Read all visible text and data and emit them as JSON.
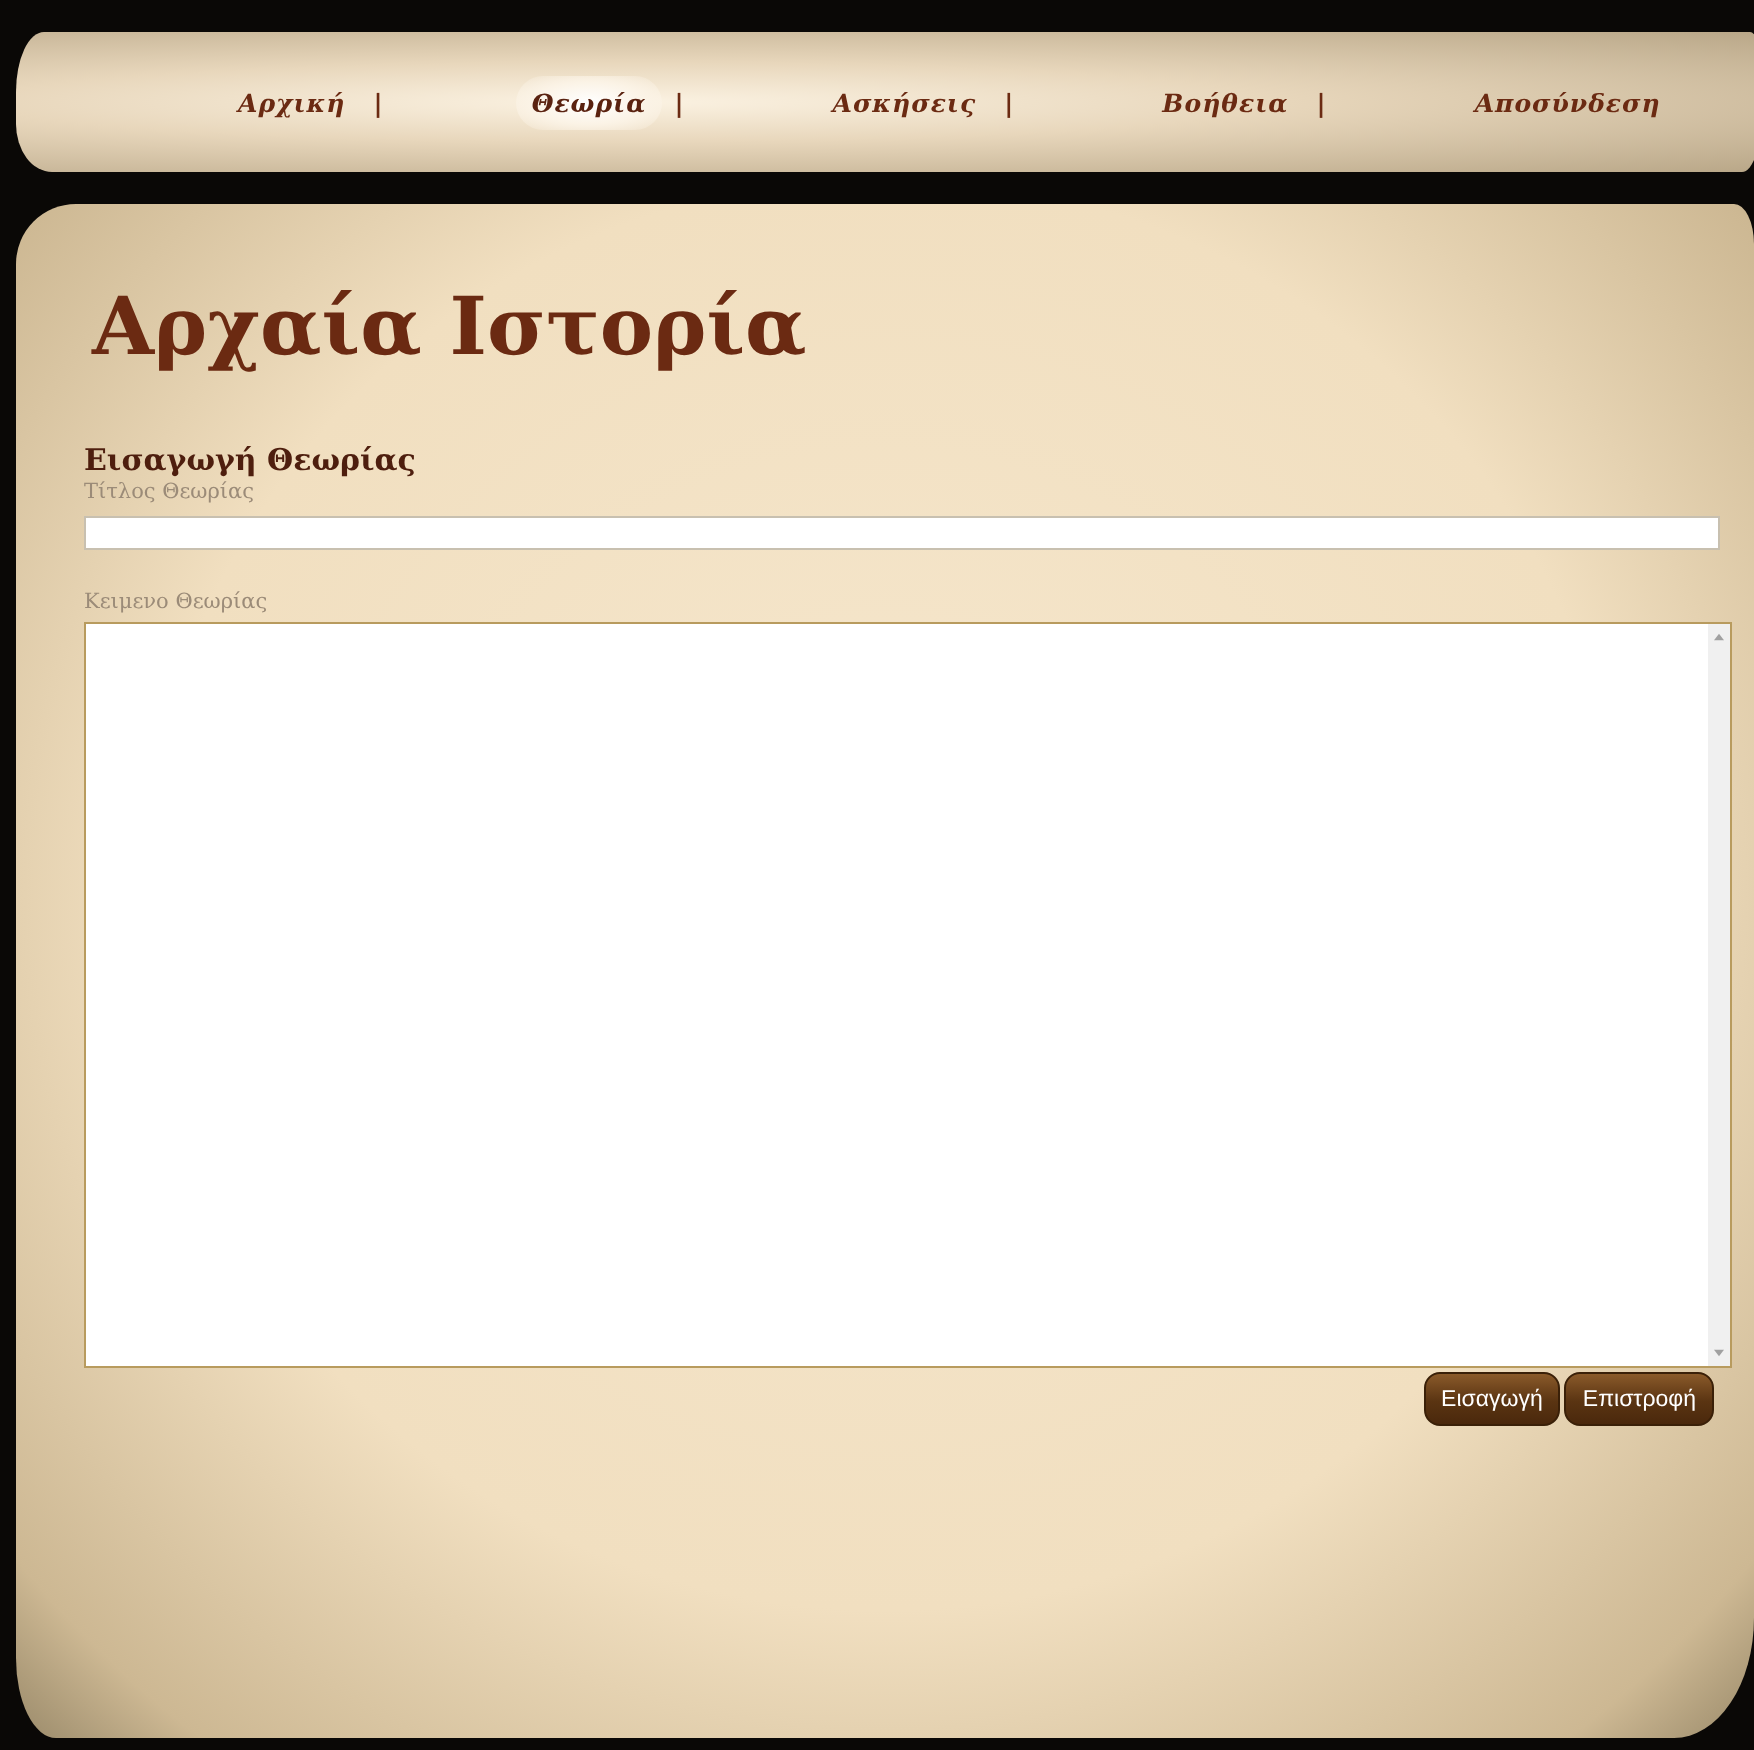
{
  "nav": {
    "items": [
      {
        "label": "Αρχική",
        "selected": false,
        "separator": "|"
      },
      {
        "label": "Θεωρία",
        "selected": true,
        "separator": "|"
      },
      {
        "label": "Ασκήσεις",
        "selected": false,
        "separator": "|"
      },
      {
        "label": "Βοήθεια",
        "selected": false,
        "separator": "|"
      },
      {
        "label": "Αποσύνδεση",
        "selected": false
      }
    ]
  },
  "page_title": "Αρχαία Ιστορία",
  "form": {
    "heading": "Εισαγωγή Θεωρίας",
    "title_field": {
      "label": "Τίτλος Θεωρίας"
    },
    "text_field": {
      "label": "Κειμενο Θεωρίας"
    },
    "buttons": [
      {
        "label": "Εισαγωγή"
      },
      {
        "label": "Επιστροφή"
      }
    ]
  }
}
